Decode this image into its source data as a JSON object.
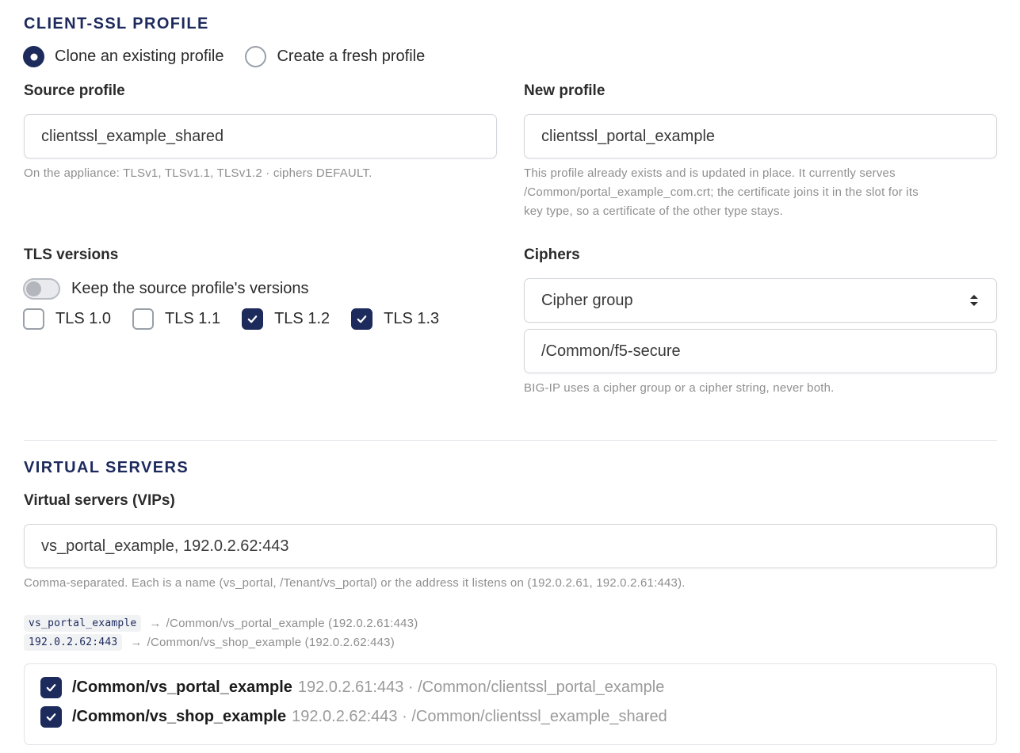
{
  "client_ssl": {
    "title": "CLIENT-SSL PROFILE",
    "mode_options": [
      {
        "label": "Clone an existing profile",
        "selected": true
      },
      {
        "label": "Create a fresh profile",
        "selected": false
      }
    ],
    "source_profile": {
      "label": "Source profile",
      "value": "clientssl_example_shared",
      "help": "On the appliance: TLSv1, TLSv1.1, TLSv1.2 · ciphers DEFAULT."
    },
    "new_profile": {
      "label": "New profile",
      "value": "clientssl_portal_example",
      "help_lines": [
        "This profile already exists and is updated in place. It currently serves",
        "/Common/portal_example_com.crt; the certificate joins it in the slot for its",
        "key type, so a certificate of the other type stays."
      ]
    },
    "tls_versions": {
      "label": "TLS versions",
      "keep_toggle_label": "Keep the source profile's versions",
      "keep_toggle_on": false,
      "options": [
        {
          "label": "TLS 1.0",
          "checked": false
        },
        {
          "label": "TLS 1.1",
          "checked": false
        },
        {
          "label": "TLS 1.2",
          "checked": true
        },
        {
          "label": "TLS 1.3",
          "checked": true
        }
      ]
    },
    "ciphers": {
      "label": "Ciphers",
      "mode_selected": "Cipher group",
      "value": "/Common/f5-secure",
      "help": "BIG-IP uses a cipher group or a cipher string, never both."
    }
  },
  "virtual_servers": {
    "title": "VIRTUAL SERVERS",
    "field_label": "Virtual servers (VIPs)",
    "value": "vs_portal_example, 192.0.2.62:443",
    "help": "Comma-separated. Each is a name (vs_portal, /Tenant/vs_portal) or the address it listens on (192.0.2.61, 192.0.2.61:443).",
    "resolutions": [
      {
        "token": "vs_portal_example",
        "arrow": "→",
        "resolved": "/Common/vs_portal_example (192.0.2.61:443)"
      },
      {
        "token": "192.0.2.62:443",
        "arrow": "→",
        "resolved": "/Common/vs_shop_example (192.0.2.62:443)"
      }
    ],
    "selected": [
      {
        "name": "/Common/vs_portal_example",
        "meta": "192.0.2.61:443 · /Common/clientssl_portal_example",
        "checked": true
      },
      {
        "name": "/Common/vs_shop_example",
        "meta": "192.0.2.62:443 · /Common/clientssl_example_shared",
        "checked": true
      }
    ]
  },
  "colors": {
    "accent": "#1d2a5c",
    "help_text": "#8f8f8f",
    "border": "#d3d6db"
  },
  "icons": {
    "checkbox_check": "check-icon",
    "select_arrows": "select-updown-icon",
    "mapping_arrow": "arrow-right-icon"
  }
}
